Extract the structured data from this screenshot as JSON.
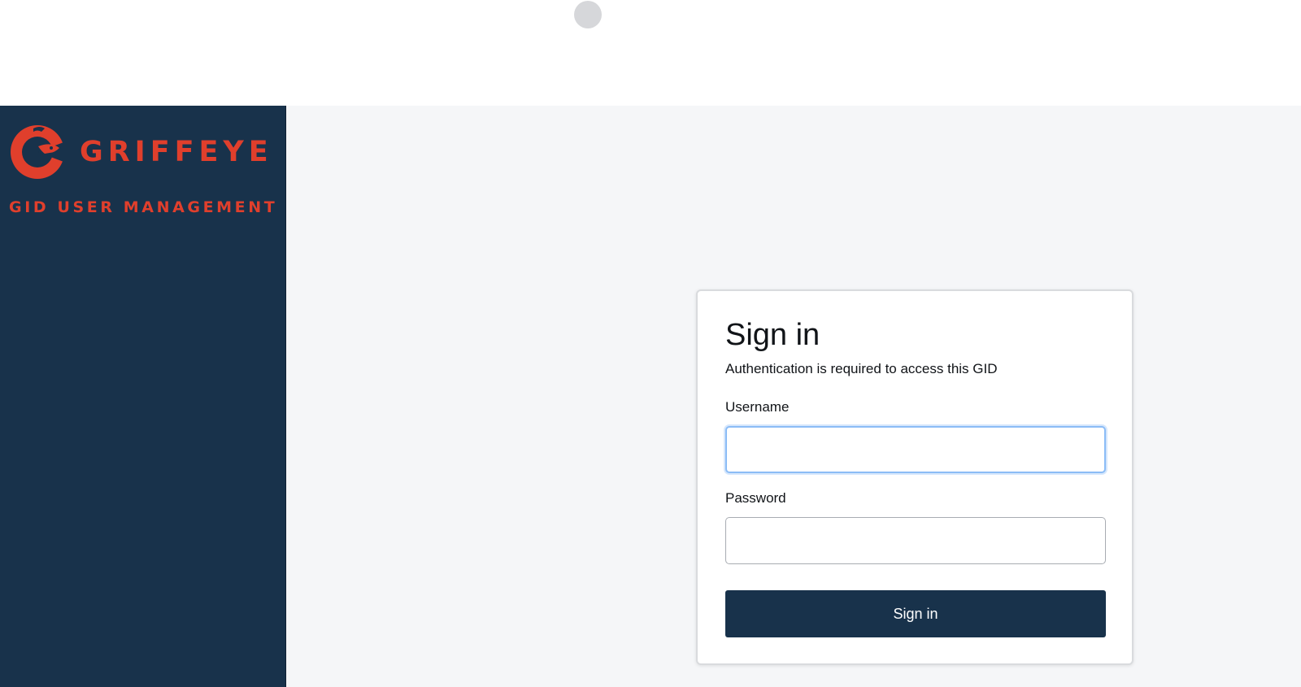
{
  "brand": {
    "name": "GRIFFEYE",
    "app_subtitle": "GID USER MANAGEMENT",
    "logo_icon": "griffeye-logo-icon",
    "accent_color": "#e03f2c"
  },
  "sidebar": {
    "background_color": "#18324b"
  },
  "signin": {
    "title": "Sign in",
    "subtitle": "Authentication is required to access this GID",
    "username_label": "Username",
    "username_value": "",
    "password_label": "Password",
    "password_value": "",
    "button_label": "Sign in",
    "focused_field": "username"
  },
  "loading_indicator": {
    "icon": "loading-dot-icon"
  }
}
